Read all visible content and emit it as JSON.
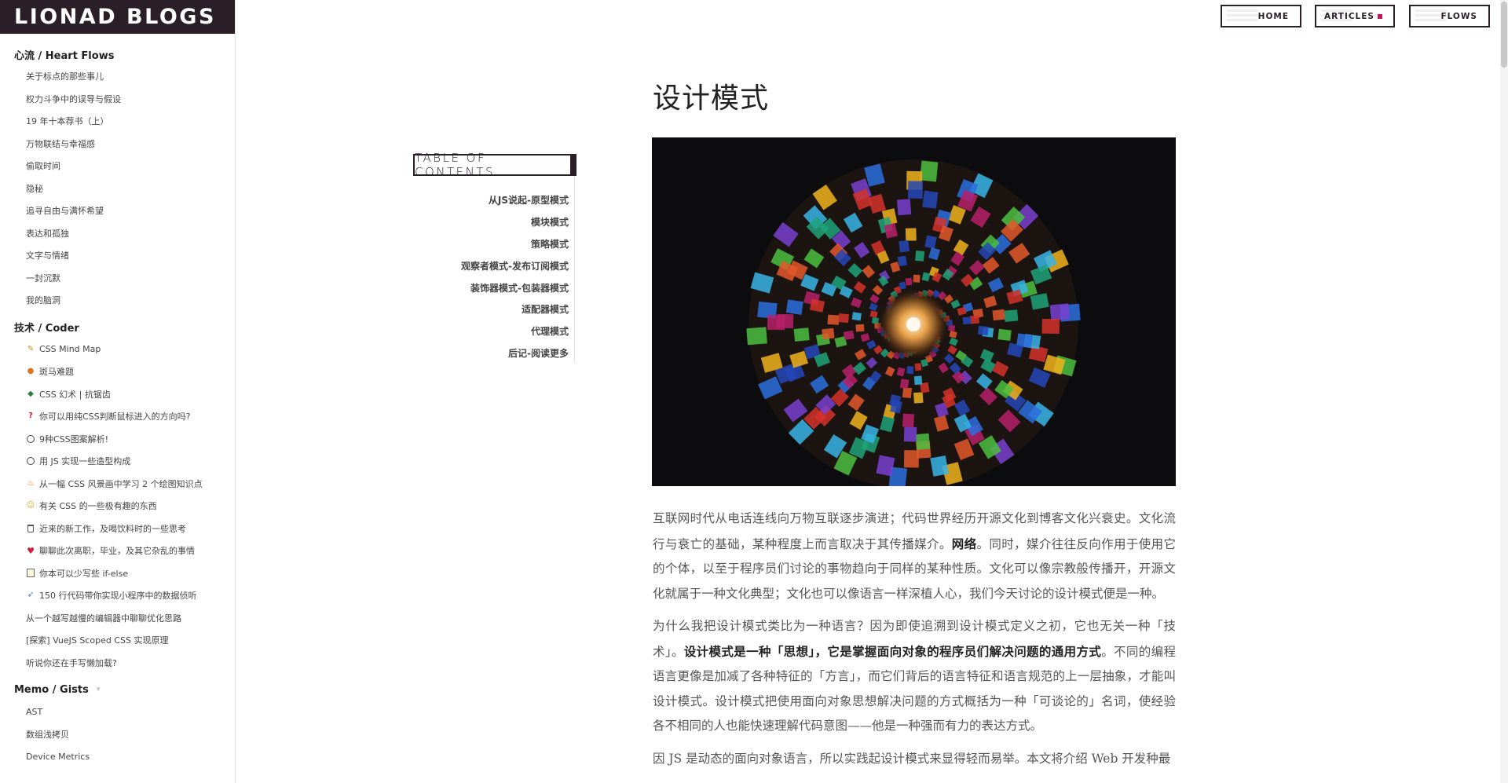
{
  "brand": "LIONAD BLOGS",
  "nav": {
    "home": "HOME",
    "articles": "ARTICLES",
    "flows": "FLOWS",
    "active_color": "#c2185b"
  },
  "sidebar": {
    "sections": [
      {
        "title": "心流 / Heart Flows",
        "items": [
          {
            "label": "关于标点的那些事儿"
          },
          {
            "label": "权力斗争中的误导与假设"
          },
          {
            "label": "19 年十本荐书（上）"
          },
          {
            "label": "万物联结与幸福感"
          },
          {
            "label": "偷取时间"
          },
          {
            "label": "隐秘"
          },
          {
            "label": "追寻自由与满怀希望"
          },
          {
            "label": "表达和孤独"
          },
          {
            "label": "文字与情绪"
          },
          {
            "label": "一封沉默"
          },
          {
            "label": "我的脑洞"
          }
        ]
      },
      {
        "title": "技术 / Coder",
        "items": [
          {
            "label": "CSS Mind Map",
            "icon": "pencil-icon"
          },
          {
            "label": "斑马难题",
            "icon": "pumpkin-icon"
          },
          {
            "label": "CSS 幻术 | 抗锯齿",
            "icon": "turtle-icon"
          },
          {
            "label": "你可以用纯CSS判断鼠标进入的方向吗?",
            "icon": "question-icon"
          },
          {
            "label": "9种CSS图案解析!",
            "icon": "circle-icon"
          },
          {
            "label": "用 JS 实现一些造型构成",
            "icon": "circle-icon"
          },
          {
            "label": "从一幅 CSS 风景画中学习 2 个绘图知识点",
            "icon": "fire-icon"
          },
          {
            "label": "有关 CSS 的一些极有趣的东西",
            "icon": "smile-icon"
          },
          {
            "label": "近来的新工作，及喝饮料时的一些思考",
            "icon": "cup-icon"
          },
          {
            "label": "聊聊此次离职，毕业，及其它杂乱的事情",
            "icon": "heart-icon"
          },
          {
            "label": "你本可以少写些 if-else",
            "icon": "memo-icon"
          },
          {
            "label": "150 行代码带你实现小程序中的数据侦听",
            "icon": "rocket-icon"
          },
          {
            "label": "从一个越写越慢的编辑器中聊聊优化思路"
          },
          {
            "label": "[探索] VueJS Scoped CSS 实现原理"
          },
          {
            "label": "听说你还在手写懒加载?"
          }
        ]
      },
      {
        "title": "Memo / Gists",
        "items": [
          {
            "label": "AST"
          },
          {
            "label": "数组浅拷贝"
          },
          {
            "label": "Device Metrics"
          }
        ]
      }
    ]
  },
  "toc": {
    "title": "TABLE OF CONTENTS",
    "items": [
      "从JS说起-原型模式",
      "模块模式",
      "策略模式",
      "观察者模式-发布订阅模式",
      "装饰器模式-包装器模式",
      "适配器模式",
      "代理模式",
      "后记-阅读更多"
    ]
  },
  "article": {
    "title": "设计模式",
    "paragraphs": [
      [
        {
          "t": "互联网时代从电话连线向万物互联逐步演进；代码世界经历开源文化到博客文化兴衰史。文化流行与衰亡的基础，某种程度上而言取决于其传播媒介。"
        },
        {
          "t": "网络",
          "b": true
        },
        {
          "t": "。同时，媒介往往反向作用于使用它的个体，以至于程序员们讨论的事物趋向于同样的某种性质。文化可以像宗教般传播开，开源文化就属于一种文化典型；文化也可以像语言一样深植人心，我们今天讨论的设计模式便是一种。"
        }
      ],
      [
        {
          "t": "为什么我把设计模式类比为一种语言？因为即使追溯到设计模式定义之初，它也无关一种「技术」。"
        },
        {
          "t": "设计模式是一种「思想」，它是掌握面向对象的程序员们解决问题的通用方式",
          "b": true
        },
        {
          "t": "。不同的编程语言更像是加减了各种特征的「方言」，而它们背后的语言特征和语言规范的上一层抽象，才能叫设计模式。设计模式把使用面向对象思想解决问题的方式概括为一种「可谈论的」名词，使经验各不相同的人也能快速理解代码意图——他是一种强而有力的表达方式。"
        }
      ],
      [
        {
          "t": "因 JS 是动态的面向对象语言，所以实践起设计模式来显得轻而易举。本文将介绍 Web 开发种最"
        }
      ]
    ]
  }
}
